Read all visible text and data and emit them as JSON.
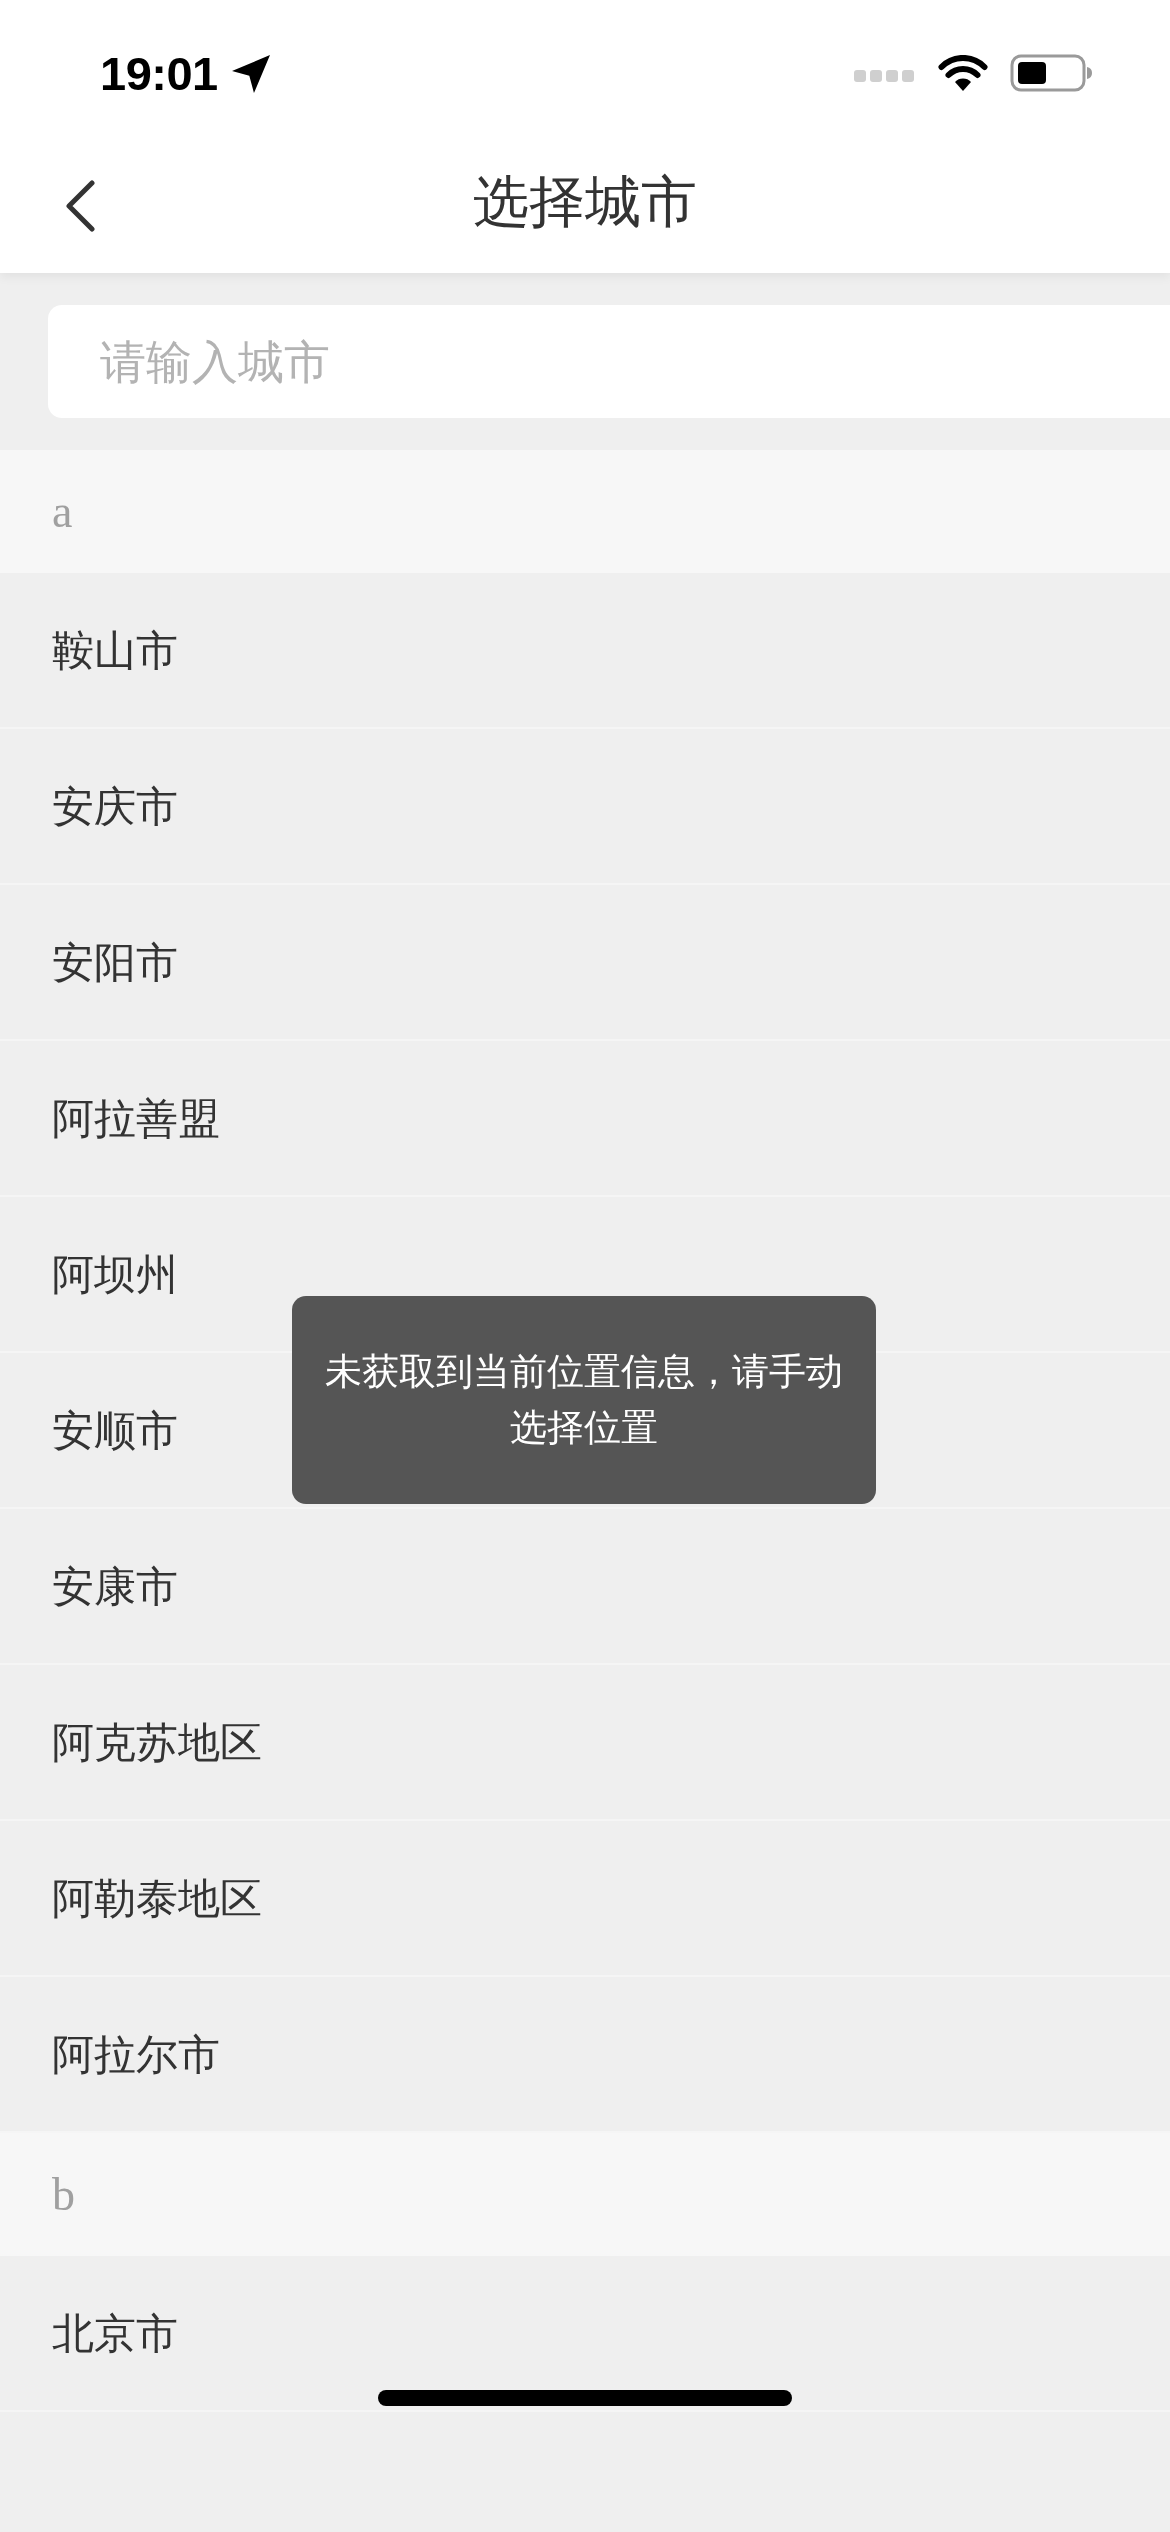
{
  "status_bar": {
    "time": "19:01"
  },
  "header": {
    "title": "选择城市"
  },
  "search": {
    "placeholder": "请输入城市"
  },
  "sections": [
    {
      "letter": "a",
      "cities": [
        "鞍山市",
        "安庆市",
        "安阳市",
        "阿拉善盟",
        "阿坝州",
        "安顺市",
        "安康市",
        "阿克苏地区",
        "阿勒泰地区",
        "阿拉尔市"
      ]
    },
    {
      "letter": "b",
      "cities": [
        "北京市"
      ]
    }
  ],
  "toast": {
    "message": "未获取到当前位置信息，请手动选择位置"
  }
}
